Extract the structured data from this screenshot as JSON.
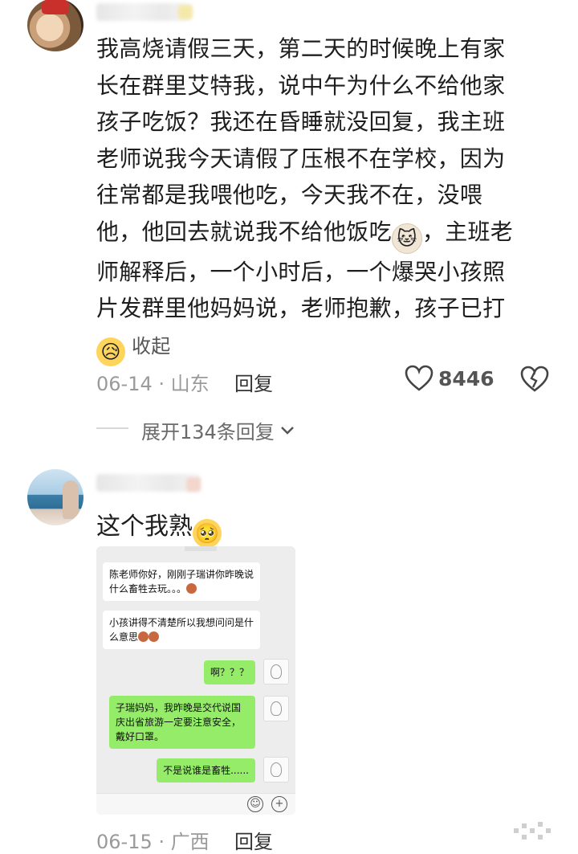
{
  "comment1": {
    "text_line1": "我高烧请假三天，第二天的时候晚上有家",
    "text_line2": "长在群里艾特我，说中午为什么不给他家",
    "text_line3": "孩子吃饭？我还在昏睡就没回复，我主班",
    "text_line4": "老师说我今天请假了压根不在学校，因为",
    "text_line5": "往常都是我喂他吃，今天我不在，没喂",
    "text_line6a": "他，他回去就说我不给他饭吃",
    "text_line6b": "，主班老",
    "text_line7": "师解释后，一个小时后，一个爆哭小孩照",
    "text_line8": "片发群里他妈妈说，老师抱歉，孩子已打",
    "collapse_label": "收起",
    "date": "06-14",
    "location": "山东",
    "reply_label": "回复",
    "likes": "8446",
    "expand_label": "展开134条回复"
  },
  "comment2": {
    "text": "这个我熟",
    "date": "06-15",
    "location": "广西",
    "reply_label": "回复",
    "chat": {
      "msg1": "陈老师你好，刚刚子瑞讲你昨晚说什么畜牲去玩。。。",
      "msg2": "小孩讲得不清楚所以我想问问是什么意思",
      "msg3": "啊？？？",
      "msg4": "子瑞妈妈，我昨晚是交代说国庆出省旅游一定要注意安全，戴好口罩。",
      "msg5": "不是说谁是畜牲......"
    }
  },
  "colors": {
    "meta_gray": "#9a9a9a",
    "chat_bg": "#ededed",
    "bubble_green": "#95ec69"
  }
}
